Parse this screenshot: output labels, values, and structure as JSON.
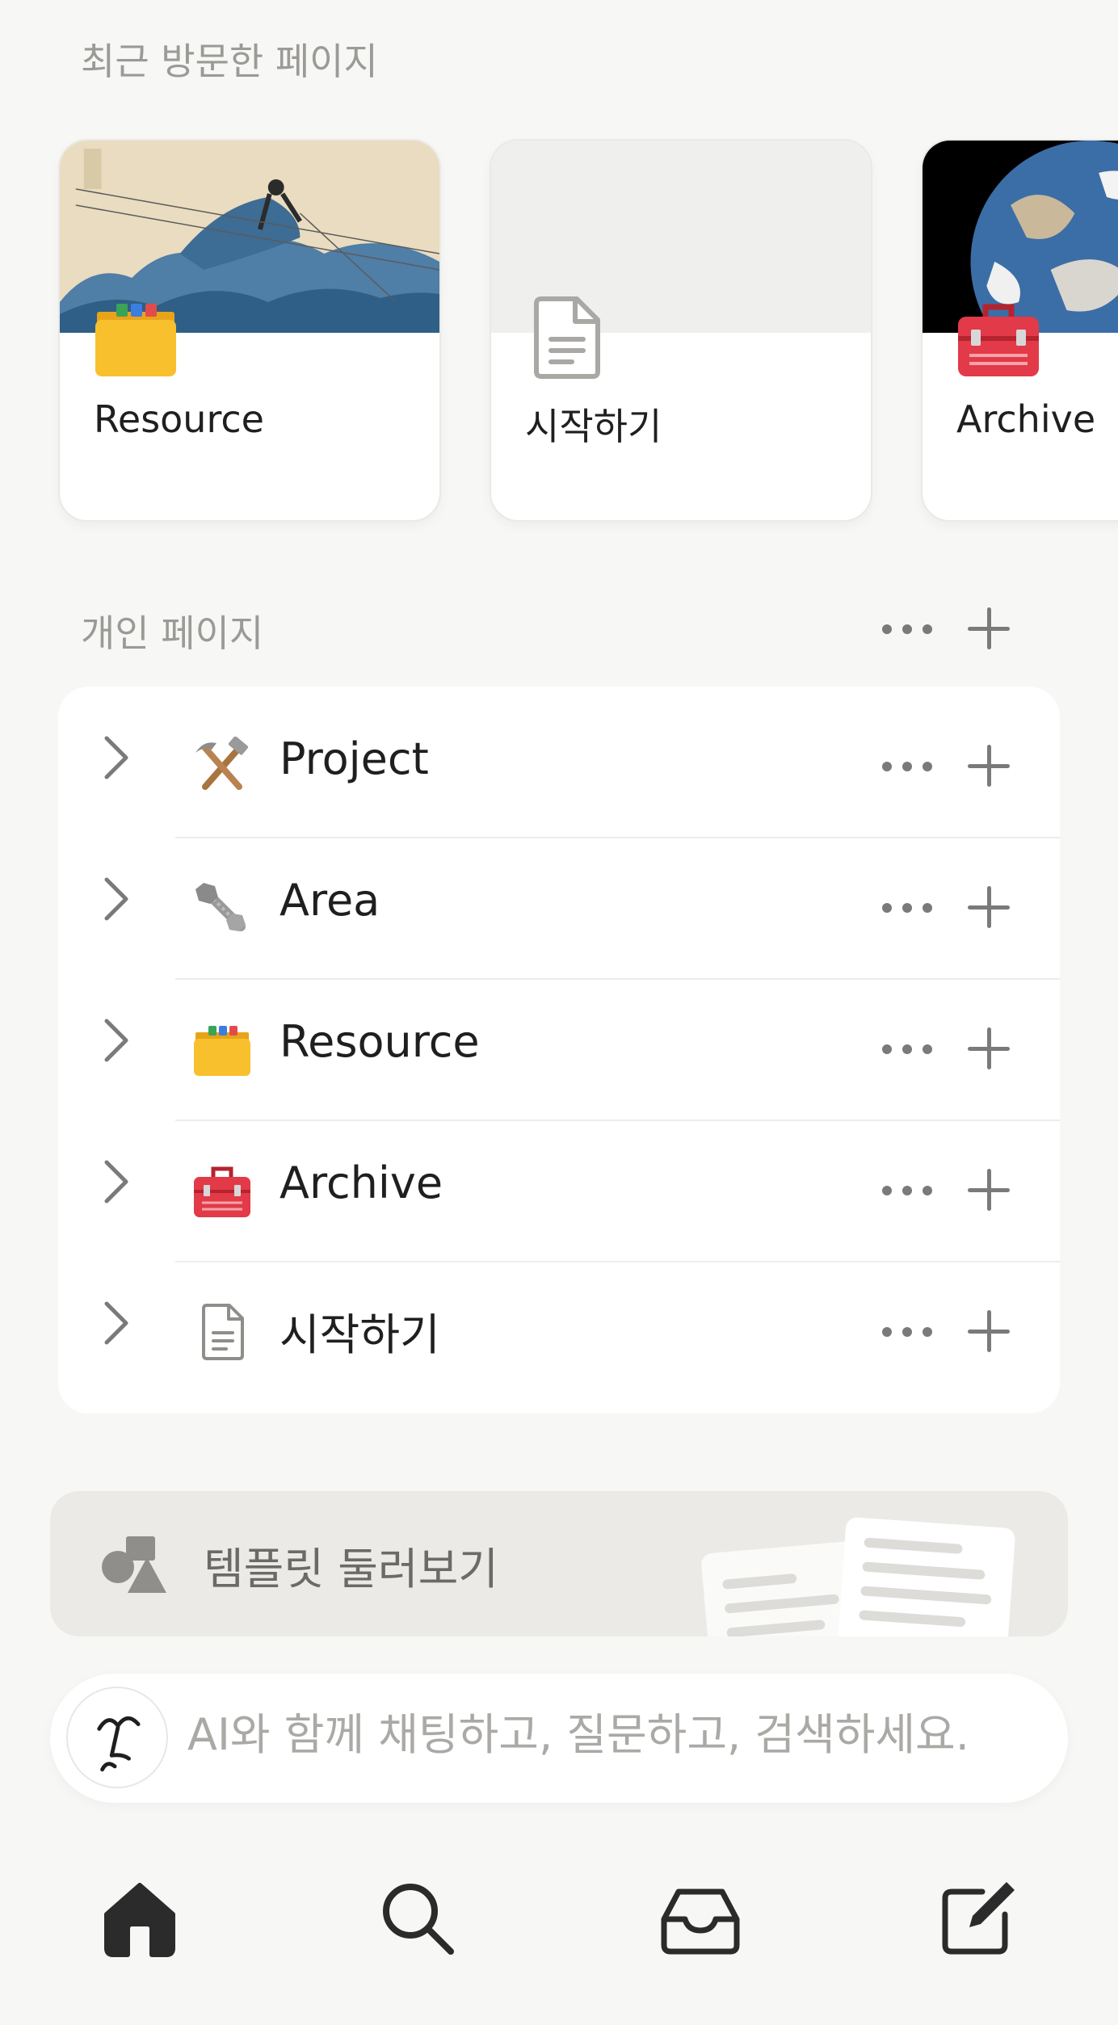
{
  "recent": {
    "title": "최근 방문한 페이지",
    "cards": [
      {
        "label": "Resource",
        "icon": "folder-icon",
        "cover": "great-wave-woodblock"
      },
      {
        "label": "시작하기",
        "icon": "document-icon",
        "cover": "plain-gray"
      },
      {
        "label": "Archive",
        "icon": "toolbox-icon",
        "cover": "earth-from-space"
      }
    ]
  },
  "personal": {
    "title": "개인 페이지",
    "pages": [
      {
        "label": "Project",
        "icon": "hammer-pick-icon"
      },
      {
        "label": "Area",
        "icon": "nut-bolt-icon"
      },
      {
        "label": "Resource",
        "icon": "folder-icon"
      },
      {
        "label": "Archive",
        "icon": "toolbox-icon"
      },
      {
        "label": "시작하기",
        "icon": "document-icon"
      }
    ]
  },
  "templates": {
    "label": "템플릿 둘러보기"
  },
  "ai": {
    "placeholder": "AI와 함께 채팅하고, 질문하고, 검색하세요."
  },
  "tabbar": {
    "tabs": [
      {
        "name": "home",
        "icon": "home-icon",
        "active": true
      },
      {
        "name": "search",
        "icon": "search-icon"
      },
      {
        "name": "inbox",
        "icon": "inbox-icon"
      },
      {
        "name": "compose",
        "icon": "compose-icon"
      }
    ]
  },
  "colors": {
    "background": "#f7f7f5",
    "card": "#ffffff",
    "muted_text": "#9b9a97",
    "icon_gray": "#7a7a78"
  }
}
